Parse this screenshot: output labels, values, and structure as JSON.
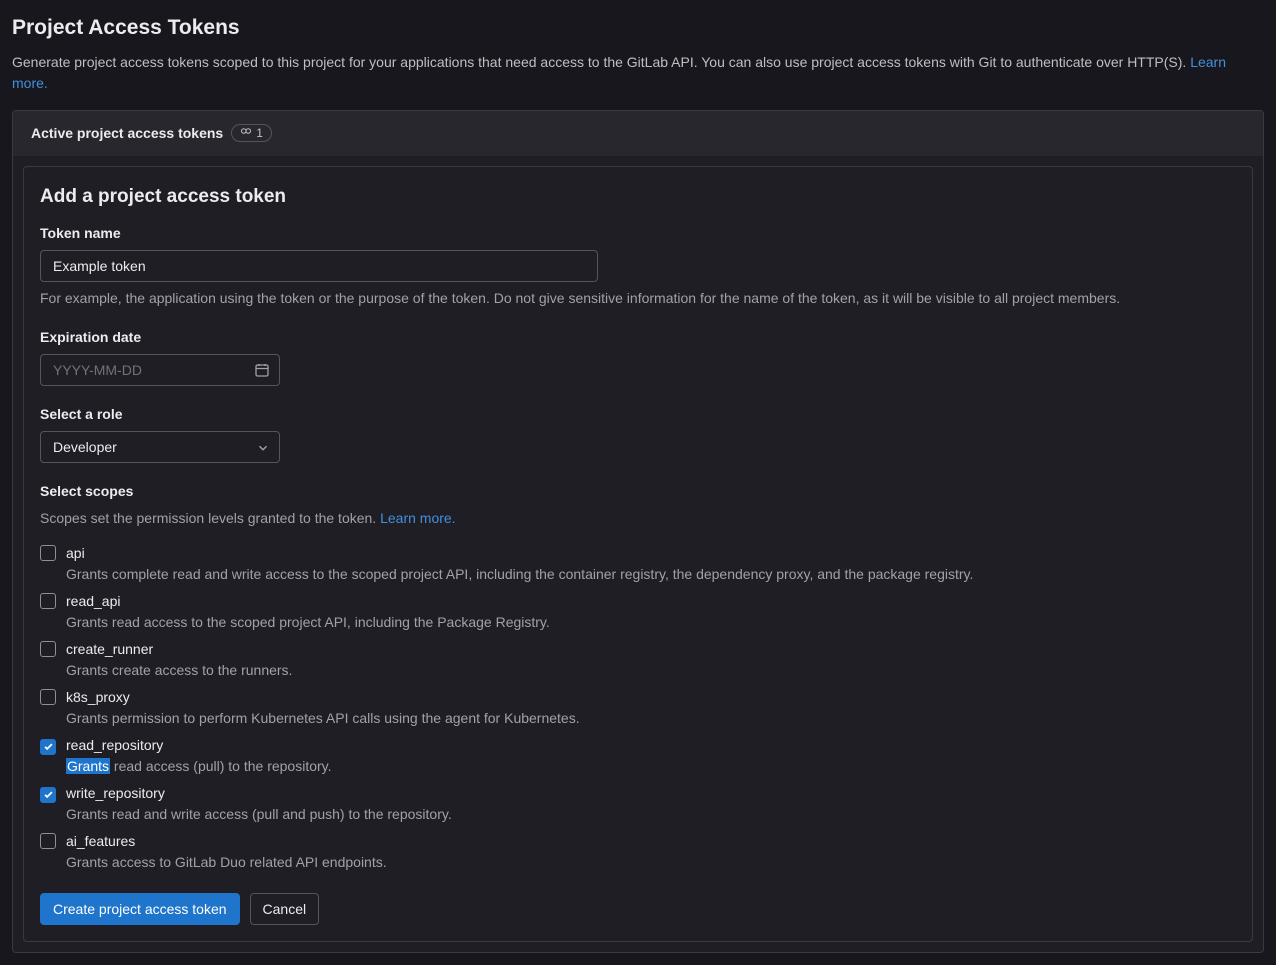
{
  "page": {
    "title": "Project Access Tokens",
    "description": "Generate project access tokens scoped to this project for your applications that need access to the GitLab API. You can also use project access tokens with Git to authenticate over HTTP(S). ",
    "learn_more": "Learn more."
  },
  "panel": {
    "header_label": "Active project access tokens",
    "badge_count": "1"
  },
  "form": {
    "heading": "Add a project access token",
    "token_name_label": "Token name",
    "token_name_value": "Example token",
    "token_name_help": "For example, the application using the token or the purpose of the token. Do not give sensitive information for the name of the token, as it will be visible to all project members.",
    "expiration_label": "Expiration date",
    "expiration_placeholder": "YYYY-MM-DD",
    "role_label": "Select a role",
    "role_value": "Developer",
    "scopes_label": "Select scopes",
    "scopes_intro": "Scopes set the permission levels granted to the token. ",
    "scopes_learn_more": "Learn more.",
    "scopes": [
      {
        "name": "api",
        "desc": "Grants complete read and write access to the scoped project API, including the container registry, the dependency proxy, and the package registry.",
        "checked": false
      },
      {
        "name": "read_api",
        "desc": "Grants read access to the scoped project API, including the Package Registry.",
        "checked": false
      },
      {
        "name": "create_runner",
        "desc": "Grants create access to the runners.",
        "checked": false
      },
      {
        "name": "k8s_proxy",
        "desc": "Grants permission to perform Kubernetes API calls using the agent for Kubernetes.",
        "checked": false
      },
      {
        "name": "read_repository",
        "desc_prefix": "Grants",
        "desc_rest": " read access (pull) to the repository.",
        "checked": true,
        "highlight_first_word": true
      },
      {
        "name": "write_repository",
        "desc": "Grants read and write access (pull and push) to the repository.",
        "checked": true
      },
      {
        "name": "ai_features",
        "desc": "Grants access to GitLab Duo related API endpoints.",
        "checked": false
      }
    ],
    "submit_label": "Create project access token",
    "cancel_label": "Cancel"
  }
}
